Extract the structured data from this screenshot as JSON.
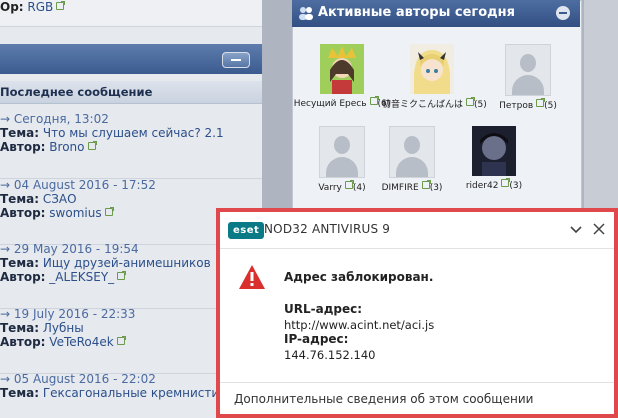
{
  "top_fragment": {
    "prefix": "Ор:",
    "link": "RGB"
  },
  "left_panel": {
    "subheader": "Последнее сообщение",
    "posts": [
      {
        "date": "Сегодня, 13:02",
        "topic_label": "Тема:",
        "topic": "Что мы слушаем сейчас? 2.1",
        "author_label": "Автор:",
        "author": "Brono"
      },
      {
        "date": "04 August 2016 - 17:52",
        "topic_label": "Тема:",
        "topic": "СЗАО",
        "author_label": "Автор:",
        "author": "swomius"
      },
      {
        "date": "29 May 2016 - 19:54",
        "topic_label": "Тема:",
        "topic": "Ищу друзей-анимешников",
        "author_label": "Автор:",
        "author": "_ALEKSEY_"
      },
      {
        "date": "19 July 2016 - 22:33",
        "topic_label": "Тема:",
        "topic": "Лубны",
        "author_label": "Автор:",
        "author": "VeTeRo4ek"
      },
      {
        "date": "05 August 2016 - 22:02",
        "topic_label": "Тема:",
        "topic": "Гексагональные кремнистишь",
        "author_label": "Автор:",
        "author": ""
      }
    ]
  },
  "right_panel": {
    "title": "Активные авторы сегодня",
    "authors": [
      {
        "name": "Несущий Ересь",
        "count": "(6)",
        "avatar": "anime-avatar-green"
      },
      {
        "name": "初音ミクこんばんは",
        "count": "(5)",
        "avatar": "anime-avatar-blonde"
      },
      {
        "name": "Петров",
        "count": "(5)",
        "avatar": "default-avatar"
      },
      {
        "name": "Varry",
        "count": "(4)",
        "avatar": "default-avatar"
      },
      {
        "name": "DIMFIRE",
        "count": "(3)",
        "avatar": "default-avatar"
      },
      {
        "name": "rider42",
        "count": "(3)",
        "avatar": "photo-avatar"
      }
    ]
  },
  "eset": {
    "logo": "eset",
    "product": "NOD32 ANTIVIRUS 9",
    "message": "Адрес заблокирован.",
    "url_label": "URL-адрес:",
    "url_value": "http://www.acint.net/aci.js",
    "ip_label": "IP-адрес:",
    "ip_value": "144.76.152.140",
    "more_info": "Дополнительные сведения об этом сообщении",
    "colors": {
      "border": "#e0494b",
      "warning": "#d9302e",
      "logo": "#0a7a86"
    }
  }
}
